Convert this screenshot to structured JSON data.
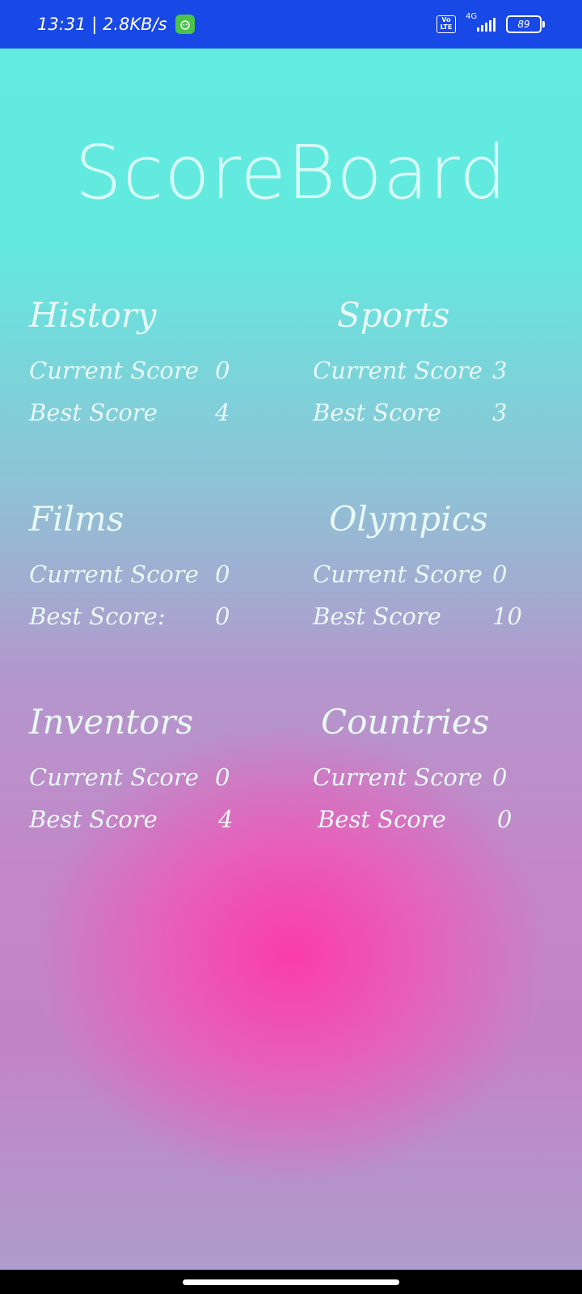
{
  "status_bar": {
    "time_speed": "13:31 | 2.8KB/s",
    "volte": "Vo LTE",
    "network": "4G",
    "battery": "89"
  },
  "title": "ScoreBoard",
  "categories": [
    {
      "name": "History",
      "current_label": "Current Score",
      "current": "0",
      "best_label": "Best Score",
      "best": "4"
    },
    {
      "name": "Sports",
      "current_label": "Current Score",
      "current": "3",
      "best_label": "Best Score",
      "best": "3"
    },
    {
      "name": "Films",
      "current_label": "Current Score",
      "current": "0",
      "best_label": "Best Score:",
      "best": "0"
    },
    {
      "name": "Olympics",
      "current_label": "Current Score",
      "current": "0",
      "best_label": "Best Score",
      "best": "10"
    },
    {
      "name": "Inventors",
      "current_label": "Current Score",
      "current": "0",
      "best_label": "Best Score",
      "best": "4"
    },
    {
      "name": "Countries",
      "current_label": "Current Score",
      "current": "0",
      "best_label": "Best Score",
      "best": "0"
    }
  ],
  "colors": {
    "status_bar": "#1848e6",
    "gradient_top": "#62ebe0",
    "gradient_center": "#f83ca8",
    "text": "#e8f8f6"
  }
}
